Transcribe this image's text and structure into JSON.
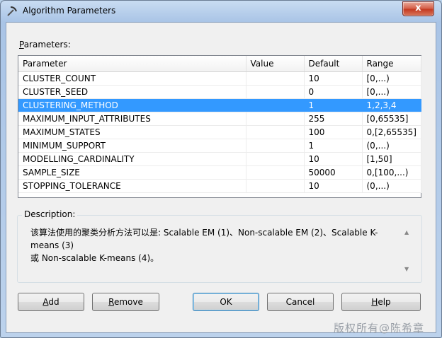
{
  "window": {
    "title": "Algorithm Parameters",
    "close_glyph": "x"
  },
  "params": {
    "label": "Parameters:",
    "columns": [
      "Parameter",
      "Value",
      "Default",
      "Range"
    ],
    "rows": [
      {
        "parameter": "CLUSTER_COUNT",
        "value": "",
        "default": "10",
        "range": "[0,...)"
      },
      {
        "parameter": "CLUSTER_SEED",
        "value": "",
        "default": "0",
        "range": "[0,...)"
      },
      {
        "parameter": "CLUSTERING_METHOD",
        "value": "",
        "default": "1",
        "range": "1,2,3,4",
        "selected": true
      },
      {
        "parameter": "MAXIMUM_INPUT_ATTRIBUTES",
        "value": "",
        "default": "255",
        "range": "[0,65535]"
      },
      {
        "parameter": "MAXIMUM_STATES",
        "value": "",
        "default": "100",
        "range": "0,[2,65535]"
      },
      {
        "parameter": "MINIMUM_SUPPORT",
        "value": "",
        "default": "1",
        "range": "(0,...)"
      },
      {
        "parameter": "MODELLING_CARDINALITY",
        "value": "",
        "default": "10",
        "range": "[1,50]"
      },
      {
        "parameter": "SAMPLE_SIZE",
        "value": "",
        "default": "50000",
        "range": "0,[100,...)"
      },
      {
        "parameter": "STOPPING_TOLERANCE",
        "value": "",
        "default": "10",
        "range": "(0,...)"
      }
    ]
  },
  "description": {
    "label": "Description:",
    "line1": "该算法使用的聚类分析方法可以是: Scalable EM (1)、Non-scalable EM (2)、Scalable K-means (3)",
    "line2": "或 Non-scalable K-means (4)。"
  },
  "buttons": {
    "add": {
      "underline": "A",
      "rest": "dd"
    },
    "remove": {
      "underline": "R",
      "rest": "emove"
    },
    "ok": "OK",
    "cancel": "Cancel",
    "help": {
      "underline": "H",
      "rest": "elp"
    }
  },
  "watermark": "版权所有@陈希章",
  "colors": {
    "selection": "#3399ff",
    "close": "#c43b22"
  }
}
